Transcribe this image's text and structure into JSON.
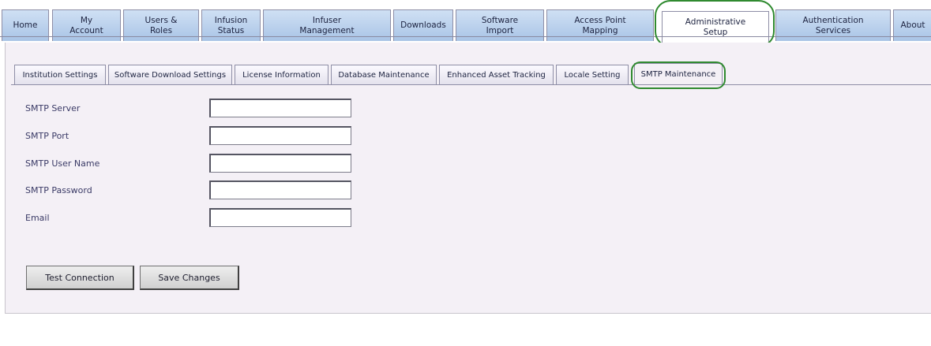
{
  "nav": {
    "tabs": [
      {
        "label": "Home"
      },
      {
        "label": "My\nAccount"
      },
      {
        "label": "Users &\nRoles"
      },
      {
        "label": "Infusion\nStatus"
      },
      {
        "label": "Infuser\nManagement"
      },
      {
        "label": "Downloads"
      },
      {
        "label": "Software\nImport"
      },
      {
        "label": "Access Point\nMapping"
      },
      {
        "label": "Administrative\nSetup"
      },
      {
        "label": "Authentication\nServices"
      },
      {
        "label": "About"
      }
    ],
    "active_index": 8
  },
  "subtabs": {
    "items": [
      {
        "label": "Institution Settings"
      },
      {
        "label": "Software Download Settings"
      },
      {
        "label": "License Information"
      },
      {
        "label": "Database Maintenance"
      },
      {
        "label": "Enhanced Asset Tracking"
      },
      {
        "label": "Locale Setting"
      },
      {
        "label": "SMTP Maintenance"
      }
    ],
    "active_index": 6
  },
  "form": {
    "smtp_server": {
      "label": "SMTP Server",
      "value": ""
    },
    "smtp_port": {
      "label": "SMTP Port",
      "value": ""
    },
    "smtp_user_name": {
      "label": "SMTP User Name",
      "value": ""
    },
    "smtp_password": {
      "label": "SMTP Password",
      "value": ""
    },
    "email": {
      "label": "Email",
      "value": ""
    }
  },
  "buttons": {
    "test_connection": "Test Connection",
    "save_changes": "Save Changes"
  },
  "colors": {
    "highlight": "#2f8a2f",
    "tab_gradient_top": "#cfe0f4",
    "tab_gradient_bottom": "#a9c4e6",
    "panel_background": "#f4f0f6"
  }
}
